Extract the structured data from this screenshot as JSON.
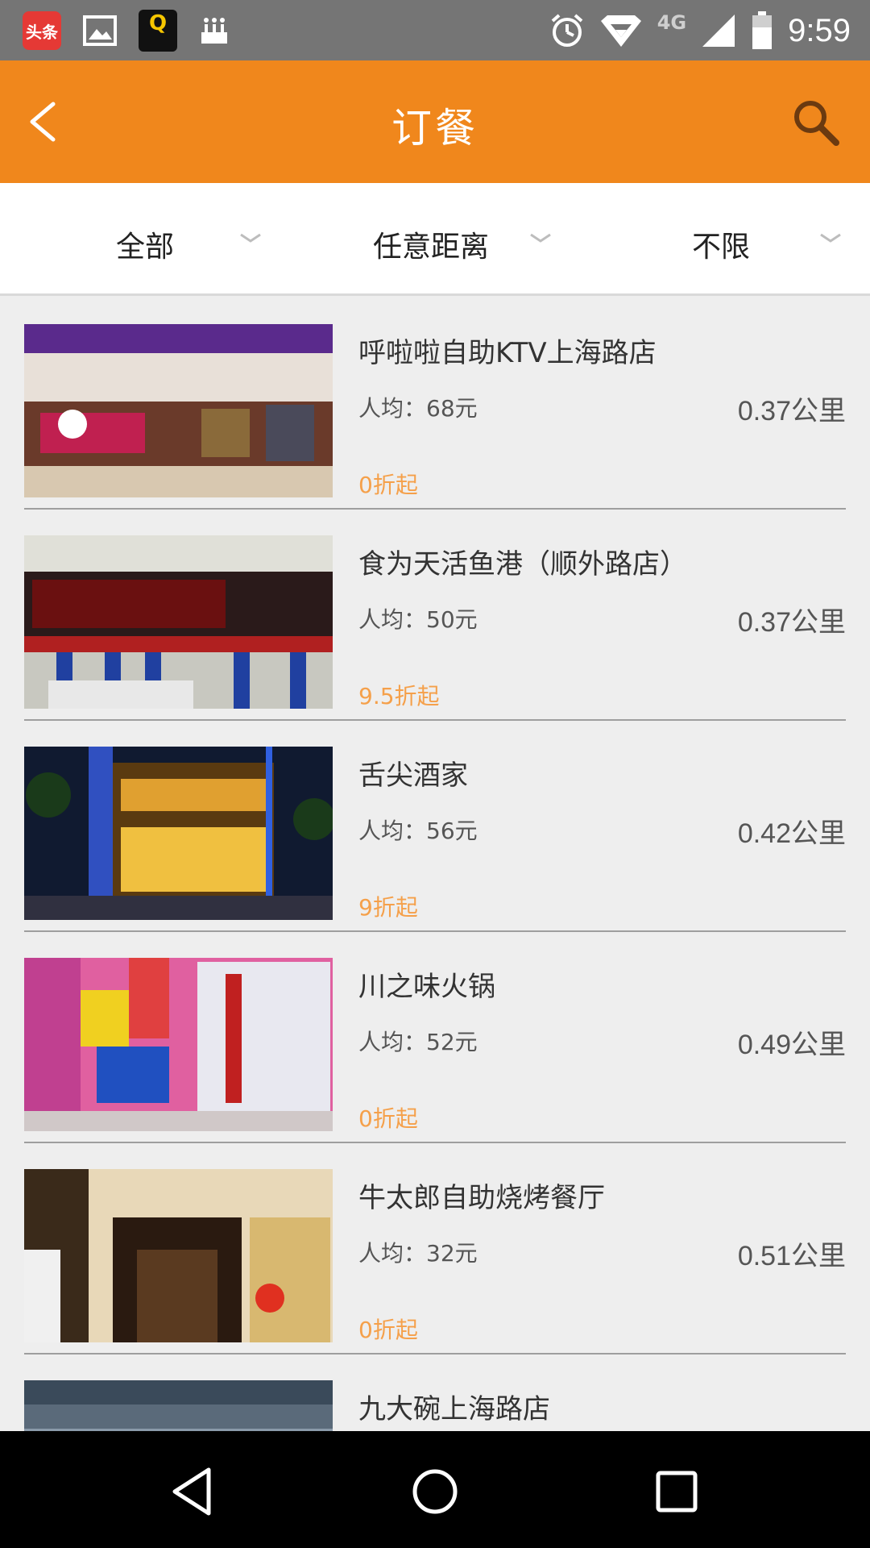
{
  "status_bar": {
    "app_badge": "头条",
    "q_badge": "Q",
    "network": "4G",
    "time": "9:59"
  },
  "header": {
    "title": "订餐"
  },
  "filters": [
    {
      "label": "全部"
    },
    {
      "label": "任意距离"
    },
    {
      "label": "不限"
    }
  ],
  "restaurants": [
    {
      "name": "呼啦啦自助KTV上海路店",
      "avg": "人均：68元",
      "distance": "0.37公里",
      "discount": "0折起"
    },
    {
      "name": "食为天活鱼港（顺外路店）",
      "avg": "人均：50元",
      "distance": "0.37公里",
      "discount": "9.5折起"
    },
    {
      "name": "舌尖酒家",
      "avg": "人均：56元",
      "distance": "0.42公里",
      "discount": "9折起"
    },
    {
      "name": "川之味火锅",
      "avg": "人均：52元",
      "distance": "0.49公里",
      "discount": "0折起"
    },
    {
      "name": "牛太郎自助烧烤餐厅",
      "avg": "人均：32元",
      "distance": "0.51公里",
      "discount": "0折起"
    },
    {
      "name": "九大碗上海路店",
      "avg": "",
      "distance": "",
      "discount": ""
    }
  ],
  "colors": {
    "header_bg": "#f0871c",
    "discount": "#f5a04a",
    "status_bar": "#757575",
    "list_bg": "#eeeeee"
  }
}
